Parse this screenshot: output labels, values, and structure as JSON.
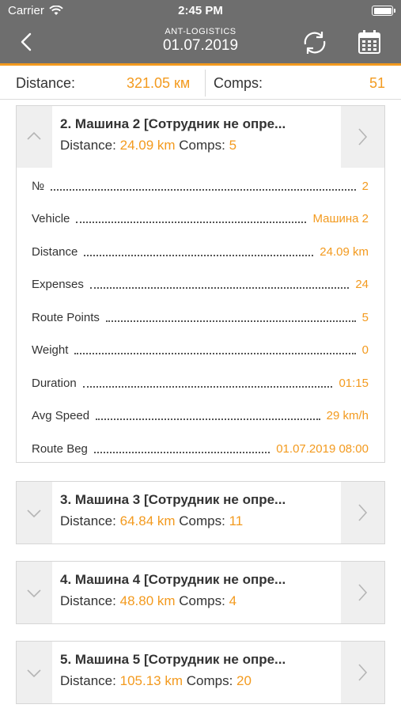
{
  "status_bar": {
    "carrier": "Carrier",
    "time": "2:45 PM"
  },
  "nav": {
    "app_name": "ANT-LOGISTICS",
    "date": "01.07.2019"
  },
  "summary": {
    "distance_label": "Distance:",
    "distance_value": "321.05 км",
    "comps_label": "Comps:",
    "comps_value": "51"
  },
  "accent_color": "#f39a1e",
  "cards": [
    {
      "title": "2. Машина 2 [Сотрудник не опре...",
      "distance_label": "Distance:",
      "distance": "24.09 km",
      "comps_label": "Comps:",
      "comps": "5",
      "expanded": true
    },
    {
      "title": "3. Машина 3 [Сотрудник не опре...",
      "distance_label": "Distance:",
      "distance": "64.84 km",
      "comps_label": "Comps:",
      "comps": "11",
      "expanded": false
    },
    {
      "title": "4. Машина 4 [Сотрудник не опре...",
      "distance_label": "Distance:",
      "distance": "48.80 km",
      "comps_label": "Comps:",
      "comps": "4",
      "expanded": false
    },
    {
      "title": "5. Машина 5 [Сотрудник не опре...",
      "distance_label": "Distance:",
      "distance": "105.13 km",
      "comps_label": "Comps:",
      "comps": "20",
      "expanded": false
    }
  ],
  "details": [
    {
      "label": "№",
      "value": "2"
    },
    {
      "label": "Vehicle",
      "value": "Машина 2"
    },
    {
      "label": "Distance",
      "value": "24.09 km"
    },
    {
      "label": "Expenses",
      "value": "24"
    },
    {
      "label": "Route Points",
      "value": "5"
    },
    {
      "label": "Weight",
      "value": "0"
    },
    {
      "label": "Duration",
      "value": "01:15"
    },
    {
      "label": "Avg Speed",
      "value": "29 km/h"
    },
    {
      "label": "Route Beg",
      "value": "01.07.2019 08:00"
    }
  ],
  "icons": [
    "wifi-icon",
    "battery-icon",
    "back-chevron-icon",
    "refresh-icon",
    "calendar-icon",
    "chevron-up-icon",
    "chevron-down-icon",
    "chevron-right-icon"
  ]
}
